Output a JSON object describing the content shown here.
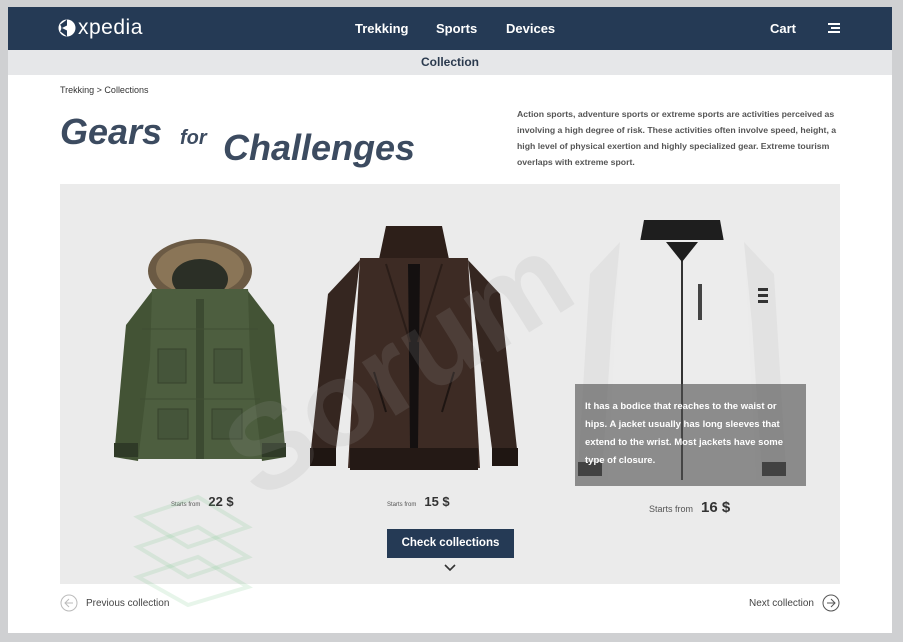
{
  "header": {
    "logo_text": "xpedia",
    "nav": [
      "Trekking",
      "Sports",
      "Devices"
    ],
    "cart_label": "Cart",
    "menu_icon": "hamburger-menu-icon"
  },
  "subbar": {
    "label": "Collection"
  },
  "breadcrumb": "Trekking > Collections",
  "headline": {
    "part1": "Gears",
    "part2": "for",
    "part3": "Challenges"
  },
  "description": "Action sports, adventure sports or extreme sports are activities perceived as involving a high degree of risk. These activities often involve speed, height, a high level of physical exertion and highly specialized gear. Extreme tourism overlaps with extreme sport.",
  "products": [
    {
      "name": "green hooded parka",
      "price_prefix": "Starts from",
      "price": "22 $",
      "color": "#4d5e3f"
    },
    {
      "name": "brown leather jacket",
      "price_prefix": "Starts from",
      "price": "15 $",
      "color": "#3d2b24"
    },
    {
      "name": "white bomber jacket",
      "price_prefix": "Starts from",
      "price": "16 $",
      "color": "#e8e8e8"
    }
  ],
  "overlay_text": " It has a bodice that reaches to the waist or hips. A jacket usually has long sleeves that extend to the wrist. Most jackets have some type of closure.",
  "cta": {
    "label": "Check collections"
  },
  "pager": {
    "prev_label": "Previous collection",
    "next_label": "Next collection"
  },
  "watermark": "Sorum",
  "colors": {
    "navy": "#253a55",
    "gallery_bg": "#ebebeb",
    "subbar_bg": "#e6e7e9"
  }
}
